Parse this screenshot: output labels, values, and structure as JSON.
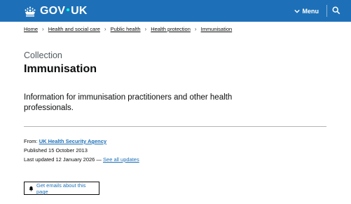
{
  "header": {
    "logo_text_left": "GOV",
    "logo_text_right": "UK",
    "menu_label": "Menu",
    "brand_color": "#1d70b8",
    "icons": [
      "crown-icon",
      "chevron-down-icon",
      "search-icon"
    ]
  },
  "breadcrumb": {
    "items": [
      "Home",
      "Health and social care",
      "Public health",
      "Health protection",
      "Immunisation"
    ]
  },
  "page": {
    "caption": "Collection",
    "title": "Immunisation",
    "description": "Information for immunisation practitioners and other health professionals."
  },
  "meta": {
    "from_label": "From:",
    "from_org": "UK Health Security Agency",
    "published": "Published 15 October 2013",
    "last_updated": "Last updated 12 January 2026 —",
    "see_all_updates": "See all updates"
  },
  "signup": {
    "label": "Get emails about this page",
    "icon": "bell-icon"
  }
}
